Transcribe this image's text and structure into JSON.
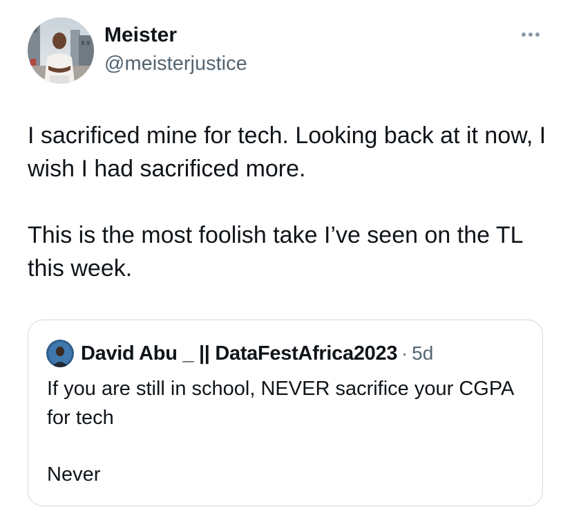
{
  "author": {
    "display_name": "Meister",
    "handle": "@meisterjustice",
    "avatar_icon": "profile-photo-avatar"
  },
  "more_icon": "more-options-icon",
  "tweet": {
    "paragraphs": [
      "I sacrificed mine for tech. Looking back at it now, I wish I had sacrificed more.",
      "This is the most foolish take I’ve seen on the TL this week."
    ]
  },
  "quoted": {
    "display_name": "David Abu _ || DataFestAfrica2023",
    "separator": "·",
    "time": "5d",
    "avatar_icon": "quoted-profile-avatar",
    "paragraphs": [
      "If you are still in school, NEVER sacrifice your CGPA for tech",
      "Never"
    ]
  },
  "colors": {
    "text_primary": "#0f1419",
    "text_secondary": "#536471",
    "border": "#cfd9de"
  }
}
